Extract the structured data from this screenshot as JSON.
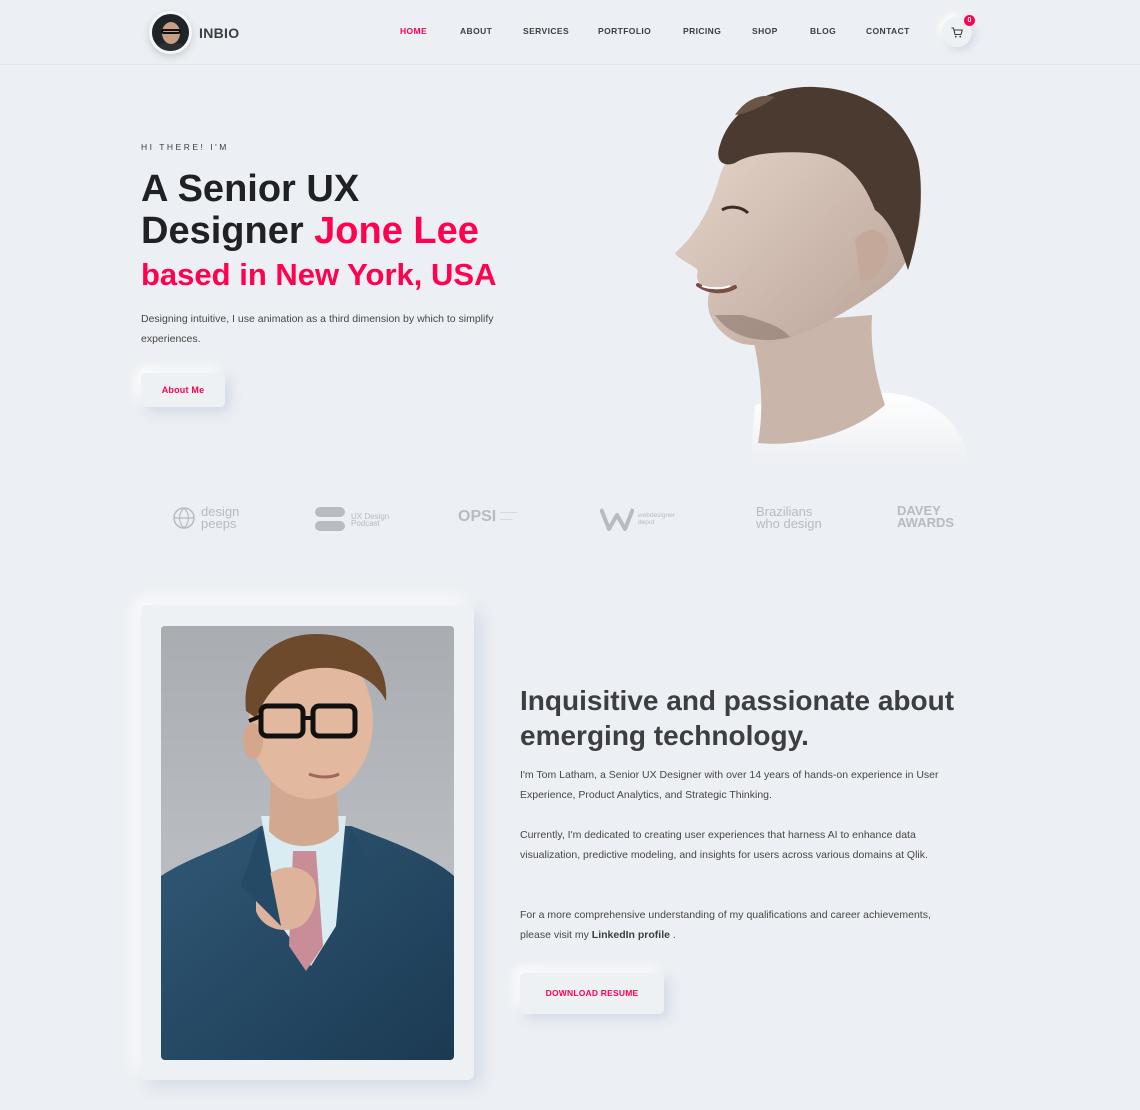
{
  "header": {
    "brand": "INBIO",
    "nav": [
      "HOME",
      "ABOUT",
      "SERVICES",
      "PORTFOLIO",
      "PRICING",
      "SHOP",
      "BLOG",
      "CONTACT"
    ],
    "active": "HOME",
    "cart_count": "0"
  },
  "hero": {
    "eyebrow": "HI THERE! I'M",
    "title_part1": "A Senior UX",
    "title_part2": "Designer ",
    "title_name": "Jone Lee",
    "subtitle": "based in New York, USA",
    "description": "Designing intuitive, I use animation as a third dimension by which to simplify experiences.",
    "button": "About Me"
  },
  "logos": [
    {
      "icon": "globe-icon",
      "text": "design peeps"
    },
    {
      "icon": "podcast-badges-icon",
      "text": "UX Design Podcast"
    },
    {
      "icon": "opsi-logo",
      "text": "OPSI"
    },
    {
      "icon": "w-logo",
      "text": "webdesigner depot"
    },
    {
      "icon": "none",
      "text": "Brazilians who design"
    },
    {
      "icon": "shield-icon",
      "text": "DAVEY AWARDS"
    }
  ],
  "about": {
    "title": "Inquisitive and passionate about emerging technology.",
    "p1": "I'm Tom Latham, a Senior UX Designer with over 14 years of hands-on experience in User Experience, Product Analytics, and Strategic Thinking.",
    "p2": "Currently, I'm dedicated to creating user experiences that harness AI to enhance data visualization, predictive modeling, and insights for users across various domains at Qlik.",
    "p3_text": "For a more comprehensive understanding of my qualifications and career achievements, please visit my ",
    "p3_link": "LinkedIn profile",
    "p3_end": " .",
    "button": "DOWNLOAD RESUME"
  },
  "colors": {
    "accent": "#ff014f",
    "background": "#eceff3",
    "text": "#3c3e41"
  }
}
